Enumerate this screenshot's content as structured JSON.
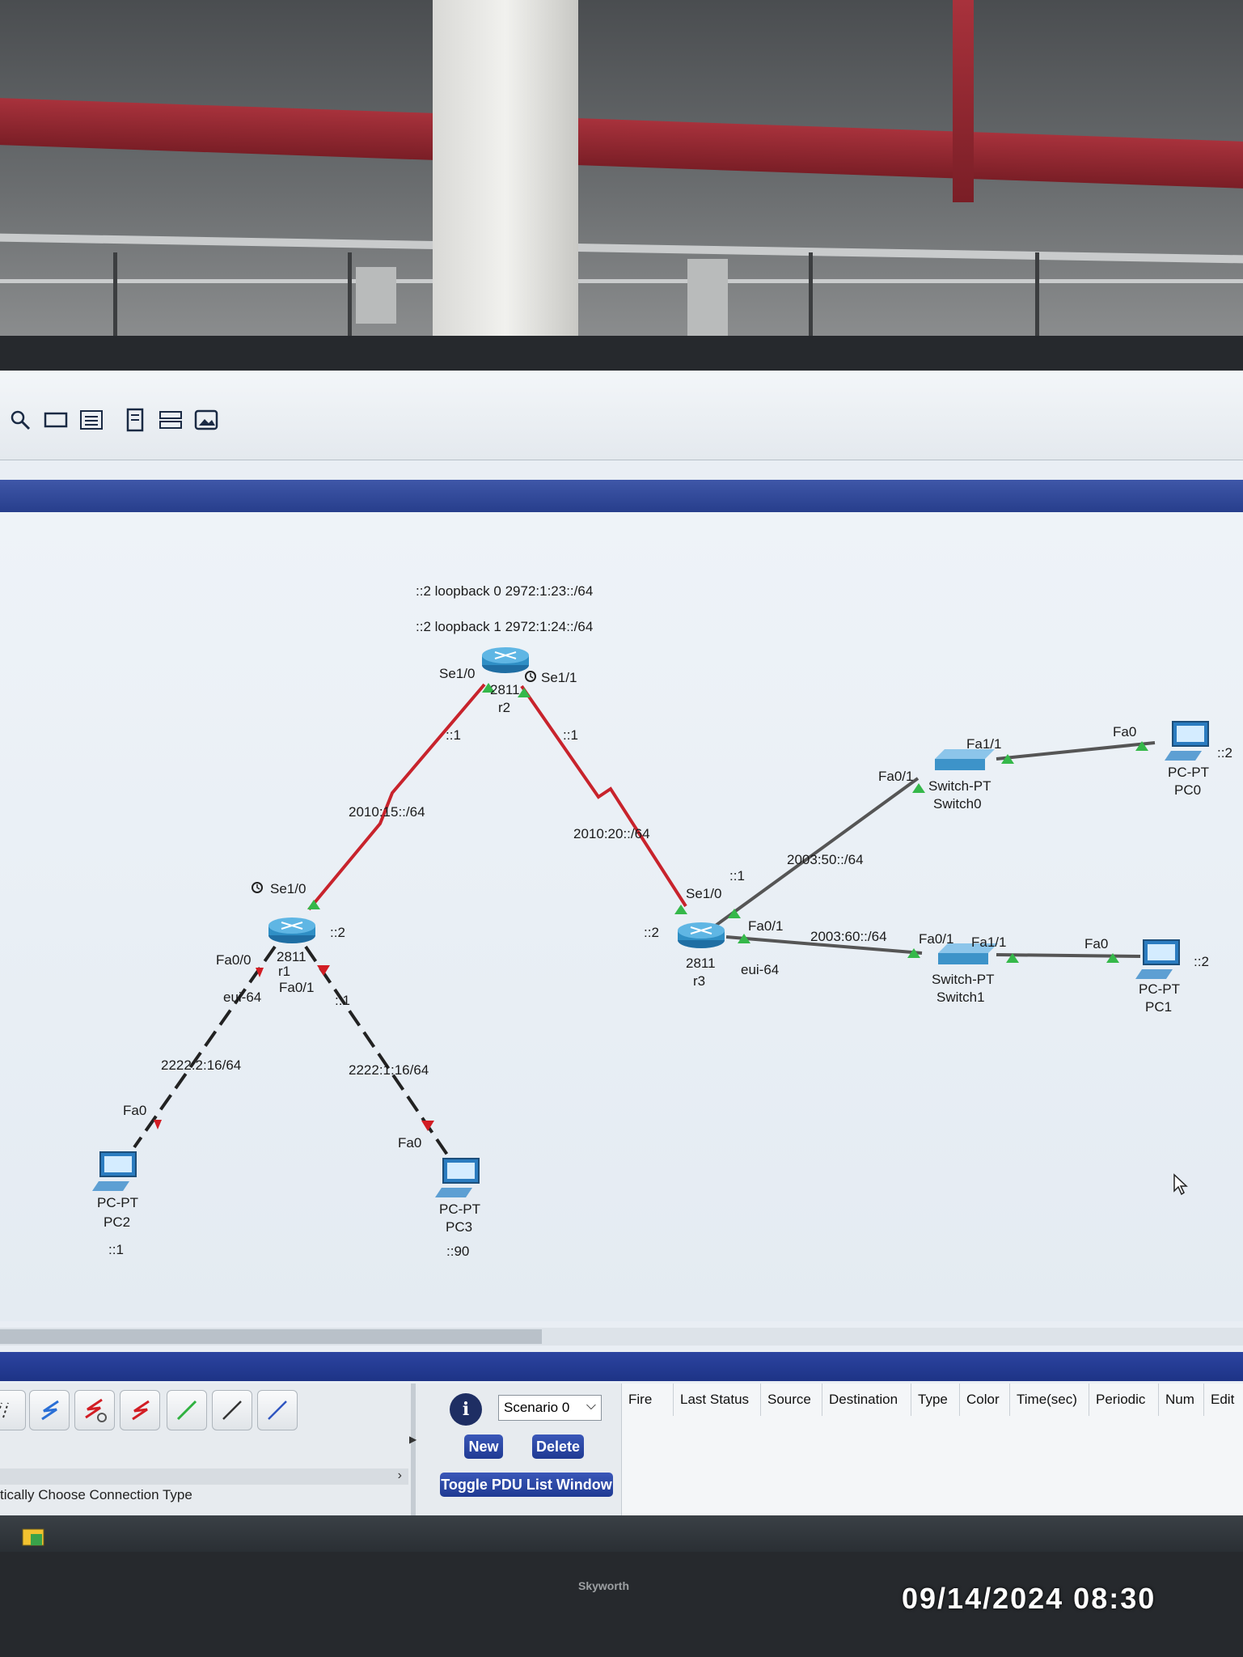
{
  "toolbar": {
    "icons": [
      "zoom-icon",
      "rectangle-icon",
      "notes-icon",
      "document-icon",
      "server-stack-icon",
      "image-icon"
    ]
  },
  "topology": {
    "r2": {
      "model": "2811",
      "name": "r2",
      "loopback0": "::2 loopback 0 2972:1:23::/64",
      "loopback1": "::2 loopback 1 2972:1:24::/64",
      "se10": "Se1/0",
      "se11": "Se1/1"
    },
    "r1": {
      "model": "2811",
      "name": "r1",
      "se10": "Se1/0",
      "fa00": "Fa0/0",
      "fa01": "Fa0/1",
      "addr": "::2"
    },
    "r3": {
      "model": "2811",
      "name": "r3",
      "se10": "Se1/0",
      "fa01": "Fa0/1",
      "addr": "::2"
    },
    "links": {
      "r1_r2_net": "2010:15::/64",
      "r1_r2_r2side": "::1",
      "r2_r3_net": "2010:20::/64",
      "r2_r3_r2side": "::1",
      "r3_sw0_net": "2003:50::/64",
      "r3_sw0_r3side": "::1",
      "r3_sw1_net": "2003:60::/64",
      "r3_sw1_mode": "eui-64",
      "r1_pc2_net": "2222:2:16/64",
      "r1_pc2_mode": "eui-64",
      "r1_pc3_net": "2222:1:16/64",
      "r1_pc3_r1side": "::1"
    },
    "switch0": {
      "type": "Switch-PT",
      "name": "Switch0",
      "fa01": "Fa0/1",
      "fa11": "Fa1/1"
    },
    "switch1": {
      "type": "Switch-PT",
      "name": "Switch1",
      "fa01": "Fa0/1",
      "fa11": "Fa1/1"
    },
    "pc0": {
      "type": "PC-PT",
      "name": "PC0",
      "port": "Fa0",
      "addr": "::2"
    },
    "pc1": {
      "type": "PC-PT",
      "name": "PC1",
      "port": "Fa0",
      "addr": "::2"
    },
    "pc2": {
      "type": "PC-PT",
      "name": "PC2",
      "port": "Fa0",
      "addr": "::1"
    },
    "pc3": {
      "type": "PC-PT",
      "name": "PC3",
      "port": "Fa0",
      "addr": "::90"
    }
  },
  "bottom": {
    "connection_status": "tically Choose Connection Type",
    "scenario": "Scenario 0",
    "new_label": "New",
    "delete_label": "Delete",
    "toggle_label": "Toggle PDU List Window",
    "info_glyph": "i",
    "pdu_columns": [
      "Fire",
      "Last Status",
      "Source",
      "Destination",
      "Type",
      "Color",
      "Time(sec)",
      "Periodic",
      "Num",
      "Edit"
    ]
  },
  "photo": {
    "brand": "Skyworth",
    "datestamp": "09/14/2024  08:30"
  },
  "colors": {
    "serial_link": "#c8232c",
    "ethernet_link": "#555555",
    "port_up": "#35b84a",
    "port_down": "#d21d24",
    "router": "#2f8fc5",
    "blue_bar": "#273e8c"
  }
}
